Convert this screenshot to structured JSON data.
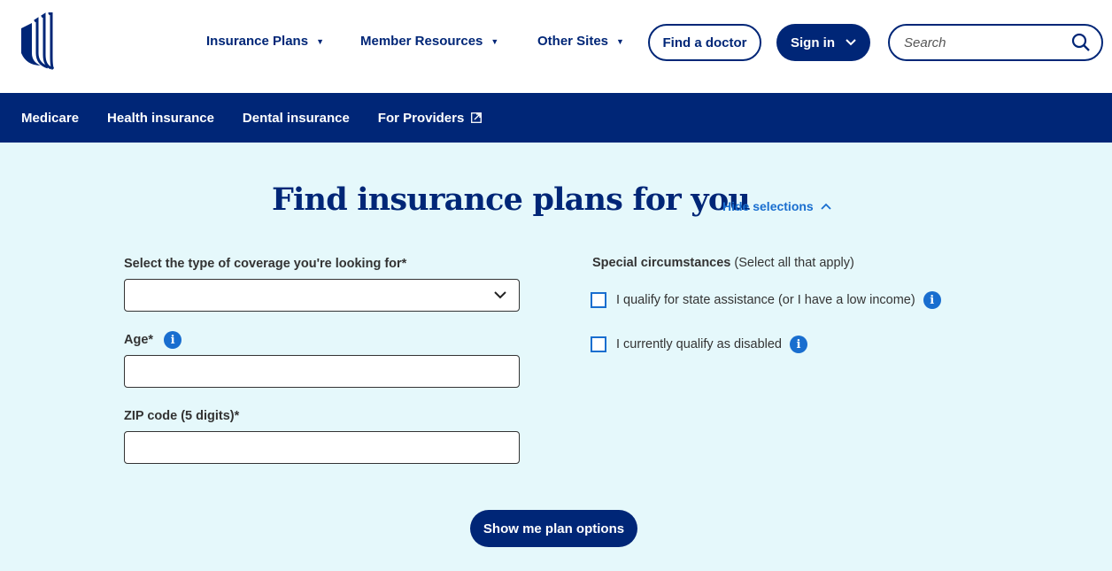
{
  "header": {
    "logo": "unitedhealthcare-logo",
    "nav": [
      {
        "label": "Insurance Plans",
        "icon": "caret-down-icon"
      },
      {
        "label": "Member Resources",
        "icon": "caret-down-icon"
      },
      {
        "label": "Other Sites",
        "icon": "caret-down-icon"
      }
    ],
    "find_doctor_label": "Find a doctor",
    "sign_in_label": "Sign in",
    "search_placeholder": "Search"
  },
  "subnav": {
    "items": [
      {
        "label": "Medicare"
      },
      {
        "label": "Health insurance"
      },
      {
        "label": "Dental insurance"
      },
      {
        "label": "For Providers",
        "icon": "external-link-icon"
      }
    ]
  },
  "form": {
    "title": "Find insurance plans for you",
    "hide_selections_label": "Hide selections",
    "coverage_label": "Select the type of coverage you're looking for*",
    "coverage_value": "",
    "age_label": "Age*",
    "age_value": "",
    "zip_label": "ZIP code (5 digits)*",
    "zip_value": "",
    "special_title": "Special circumstances",
    "special_hint": "(Select all that apply)",
    "checkboxes": [
      {
        "label": "I qualify for state assistance (or I have a low income)",
        "checked": false
      },
      {
        "label": "I currently qualify as disabled",
        "checked": false
      }
    ],
    "info_glyph": "i",
    "submit_label": "Show me plan options"
  },
  "colors": {
    "brand_navy": "#002677",
    "accent_blue": "#196ecf",
    "form_background": "#e5f8fb"
  }
}
